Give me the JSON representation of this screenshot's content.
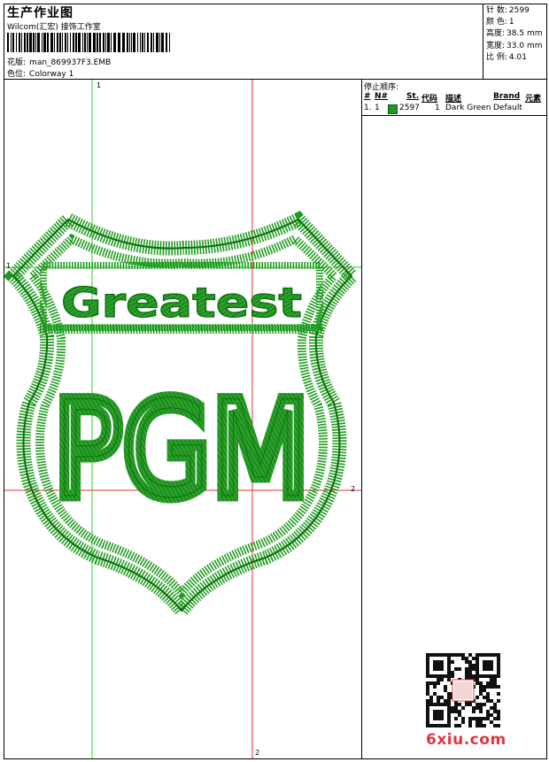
{
  "header": {
    "title": "生产作业图",
    "subtitle": "Wilcom(汇宏) 接饰工作室",
    "design_label": "花版:",
    "design_value": "man_869937F3.EMB",
    "colorway_label": "色位:",
    "colorway_value": "Colorway 1"
  },
  "stats": [
    {
      "label": "针 数:",
      "value": "2599"
    },
    {
      "label": "颜 色:",
      "value": "1"
    },
    {
      "label": "高度:",
      "value": "38.5 mm"
    },
    {
      "label": "宽度:",
      "value": "33.0 mm"
    },
    {
      "label": "比 例:",
      "value": "4.01"
    }
  ],
  "stop_panel": {
    "heading": "停止顺序:",
    "columns": [
      "#",
      "N#",
      "St.",
      "代码",
      "描述",
      "Brand",
      "元素"
    ],
    "rows": [
      {
        "num": "1.",
        "n": "1",
        "stitches": "2597",
        "code": "1",
        "desc": "Dark Green",
        "brand": "Default",
        "color": "#1e9a1e"
      }
    ]
  },
  "markers": {
    "green_label": "1",
    "red_label": "2"
  },
  "design_colors": {
    "stitch": "#1f9b1f",
    "stitch_dark": "#0d6d0d",
    "guide_green": "#33cc33",
    "guide_red": "#e03030"
  },
  "design_text": {
    "banner": "Greatest",
    "logo": "PGM"
  },
  "watermark": {
    "text": "6xiu.com",
    "seal": "以绣会友"
  }
}
